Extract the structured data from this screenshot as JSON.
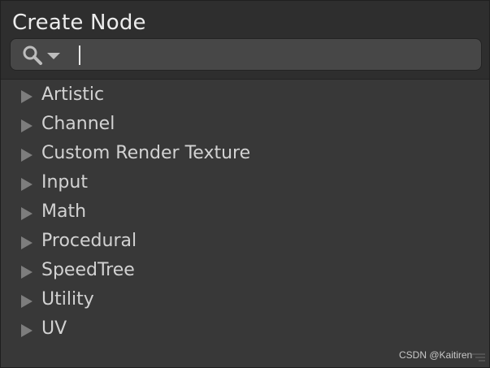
{
  "window": {
    "title": "Create Node"
  },
  "search": {
    "value": "",
    "placeholder": ""
  },
  "tree": {
    "items": [
      {
        "label": "Artistic"
      },
      {
        "label": "Channel"
      },
      {
        "label": "Custom Render Texture"
      },
      {
        "label": "Input"
      },
      {
        "label": "Math"
      },
      {
        "label": "Procedural"
      },
      {
        "label": "SpeedTree"
      },
      {
        "label": "Utility"
      },
      {
        "label": "UV"
      }
    ]
  },
  "watermark": "CSDN @Kaitiren",
  "icons": {
    "search": "search-icon",
    "dropdown": "chevron-down-icon",
    "expand": "triangle-right-icon",
    "resize": "resize-grip-icon"
  },
  "colors": {
    "background": "#383838",
    "header": "#2e2e2e",
    "search_field": "#474747",
    "text": "#d2d2d2",
    "arrow": "#7d7d7d"
  }
}
